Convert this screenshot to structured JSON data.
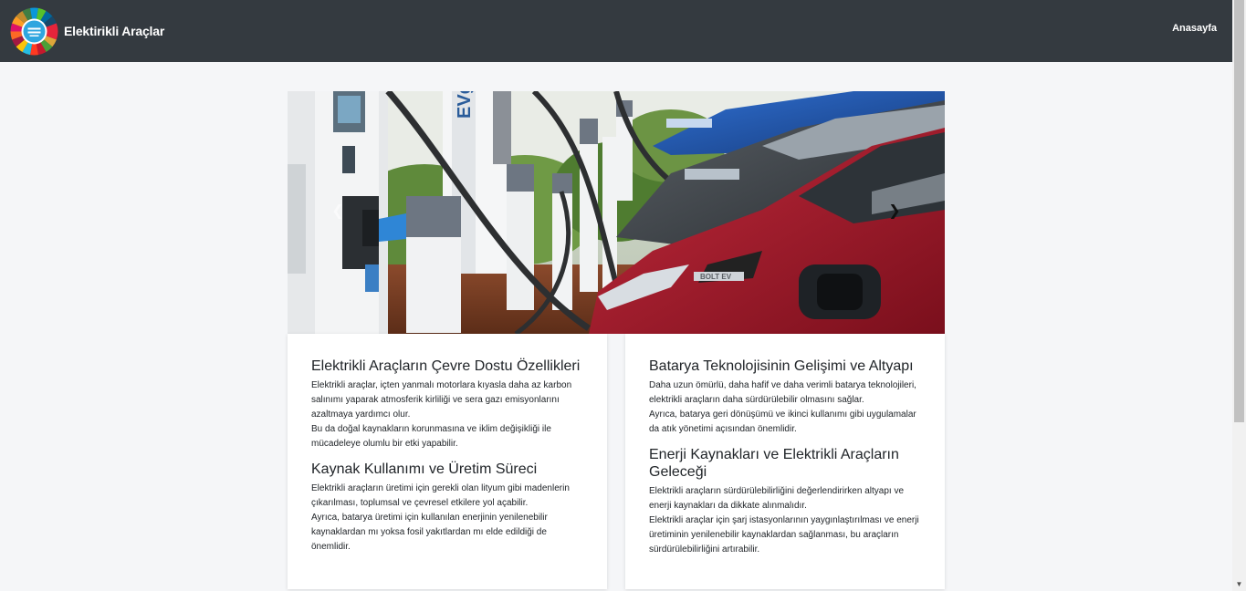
{
  "navbar": {
    "brand_title": "Elektirikli Araçlar",
    "logo_icon": "sdg-wheel-logo",
    "home_link": "Anasayfa",
    "background": "#343a40"
  },
  "carousel": {
    "image_icon": "electric-cars-charging-station-photo",
    "prev_icon": "chevron-left-icon",
    "next_icon": "chevron-right-icon",
    "station_text": "EVgo",
    "car_badge": "BOLT EV"
  },
  "cards": [
    {
      "sections": [
        {
          "title": "Elektrikli Araçların Çevre Dostu Özellikleri",
          "line1": "Elektrikli araçlar, içten yanmalı motorlara kıyasla daha az karbon salınımı yaparak atmosferik kirliliği ve sera gazı emisyonlarını azaltmaya yardımcı olur.",
          "line2": "Bu da doğal kaynakların korunmasına ve iklim değişikliği ile mücadeleye olumlu bir etki yapabilir."
        },
        {
          "title": "Kaynak Kullanımı ve Üretim Süreci",
          "line1": "Elektrikli araçların üretimi için gerekli olan lityum gibi madenlerin çıkarılması, toplumsal ve çevresel etkilere yol açabilir.",
          "line2": "Ayrıca, batarya üretimi için kullanılan enerjinin yenilenebilir kaynaklardan mı yoksa fosil yakıtlardan mı elde edildiği de önemlidir."
        }
      ]
    },
    {
      "sections": [
        {
          "title": "Batarya Teknolojisinin Gelişimi ve Altyapı",
          "line1": "Daha uzun ömürlü, daha hafif ve daha verimli batarya teknolojileri, elektrikli araçların daha sürdürülebilir olmasını sağlar.",
          "line2": "Ayrıca, batarya geri dönüşümü ve ikinci kullanımı gibi uygulamalar da atık yönetimi açısından önemlidir."
        },
        {
          "title": "Enerji Kaynakları ve Elektrikli Araçların Geleceği",
          "line1": "Elektrikli araçların sürdürülebilirliğini değerlendirirken altyapı ve enerji kaynakları da dikkate alınmalıdır.",
          "line2": "Elektrikli araçlar için şarj istasyonlarının yaygınlaştırılması ve enerji üretiminin yenilenebilir kaynaklardan sağlanması, bu araçların sürdürülebilirliğini artırabilir."
        }
      ]
    }
  ],
  "scrollbar": {
    "up_icon": "scroll-up-arrow-icon",
    "down_icon": "scroll-down-arrow-icon"
  }
}
